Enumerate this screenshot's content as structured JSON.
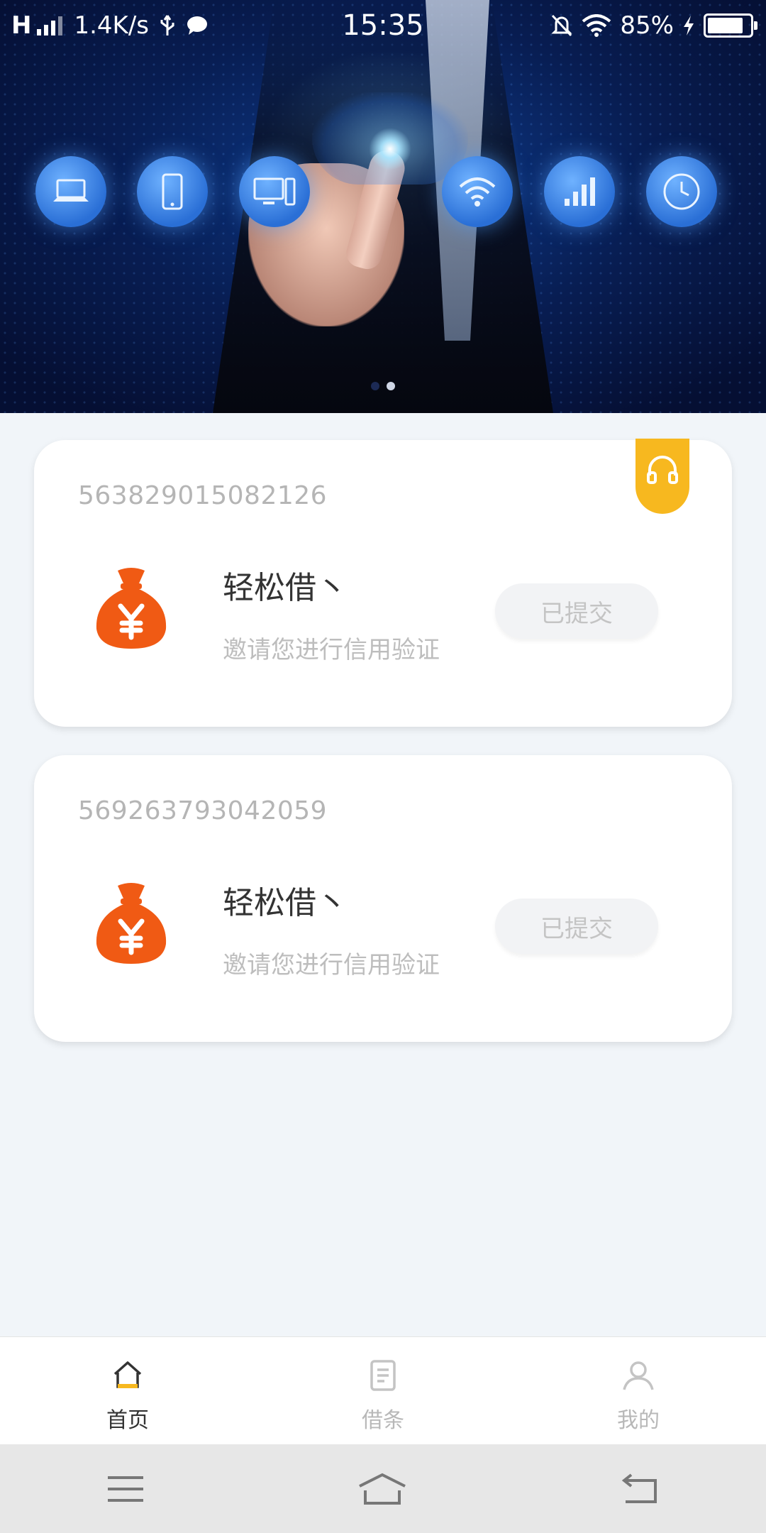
{
  "status_bar": {
    "network": "H",
    "speed": "1.4K/s",
    "time": "15:35",
    "battery_percent": "85%",
    "battery_level": 0.85
  },
  "banner": {
    "active_page": 2,
    "page_count": 2,
    "icons": [
      "laptop-icon",
      "phone-icon",
      "desktop-icon",
      "cloud-icon",
      "wifi-icon",
      "signal-icon",
      "clock-icon"
    ]
  },
  "applications": [
    {
      "number": "563829015082126",
      "title": "轻松借丶",
      "subtitle": "邀请您进行信用验证",
      "button": "已提交",
      "has_support_badge": true
    },
    {
      "number": "569263793042059",
      "title": "轻松借丶",
      "subtitle": "邀请您进行信用验证",
      "button": "已提交",
      "has_support_badge": false
    }
  ],
  "tabs": [
    {
      "label": "首页",
      "icon": "home-icon",
      "active": true
    },
    {
      "label": "借条",
      "icon": "document-icon",
      "active": false
    },
    {
      "label": "我的",
      "icon": "user-icon",
      "active": false
    }
  ],
  "colors": {
    "accent": "#f7b81f",
    "logo_orange": "#f05a14",
    "active_tab_text": "#333333",
    "inactive_tab_text": "#b8b8b8",
    "page_bg": "#f1f5f9"
  }
}
